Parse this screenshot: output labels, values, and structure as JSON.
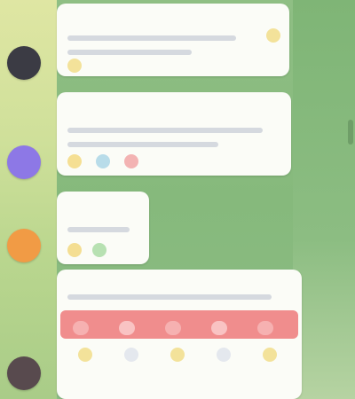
{
  "colors": {
    "avatar_1": "#3b3b44",
    "avatar_2": "#8d78e6",
    "avatar_3": "#f19b45",
    "avatar_4": "#584a4e",
    "name_1": "#7b6be2",
    "name_2": "#9e87f0",
    "name_3": "#f07a58",
    "name_4": "#5d9bdc",
    "accent_red": "#f08d8d"
  },
  "icons": {
    "pin": "pin-icon",
    "reaction": "emoji-reaction-icon"
  },
  "chat": {
    "messages": [
      {
        "initials": "",
        "sender": "",
        "text": ""
      },
      {
        "initials": "",
        "sender": "",
        "text": ""
      },
      {
        "initials": "",
        "sender": "",
        "text": ""
      },
      {
        "initials": "",
        "sender": "",
        "text": ""
      }
    ]
  }
}
